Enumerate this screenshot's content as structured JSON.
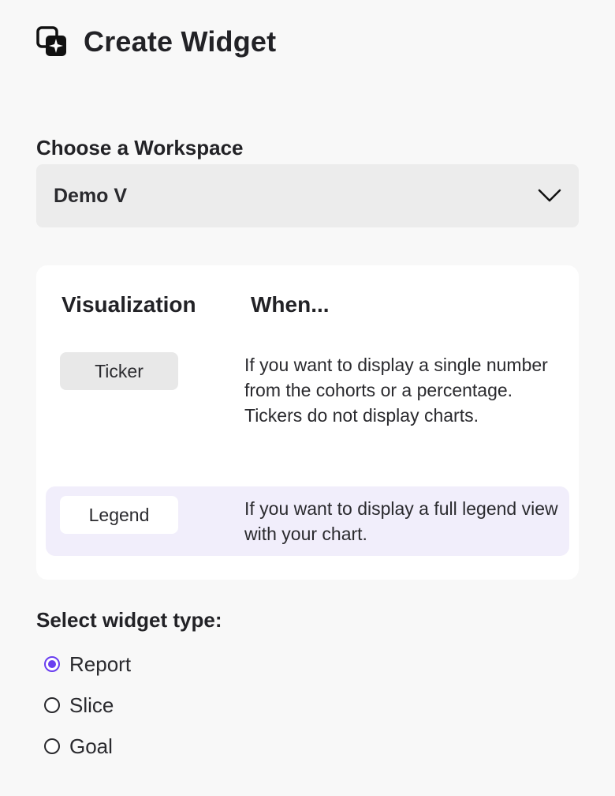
{
  "header": {
    "title": "Create Widget",
    "icon": "widget-sparkle-icon"
  },
  "workspace": {
    "label": "Choose a Workspace",
    "selected": "Demo V",
    "icon": "chevron-down-icon"
  },
  "visualization": {
    "col_visualization": "Visualization",
    "col_when": "When...",
    "rows": [
      {
        "name": "Ticker",
        "description": "If you want to display a single number from the cohorts or a percentage. Tickers do not display charts.",
        "highlighted": false
      },
      {
        "name": "Legend",
        "description": "If you want to display a full legend view with your chart.",
        "highlighted": true
      }
    ]
  },
  "widget_type": {
    "label": "Select widget type:",
    "options": [
      {
        "label": "Report",
        "checked": true
      },
      {
        "label": "Slice",
        "checked": false
      },
      {
        "label": "Goal",
        "checked": false
      }
    ]
  },
  "colors": {
    "accent": "#6a3ff0",
    "highlight_row": "#f1eefb",
    "background": "#f8f8f8"
  }
}
